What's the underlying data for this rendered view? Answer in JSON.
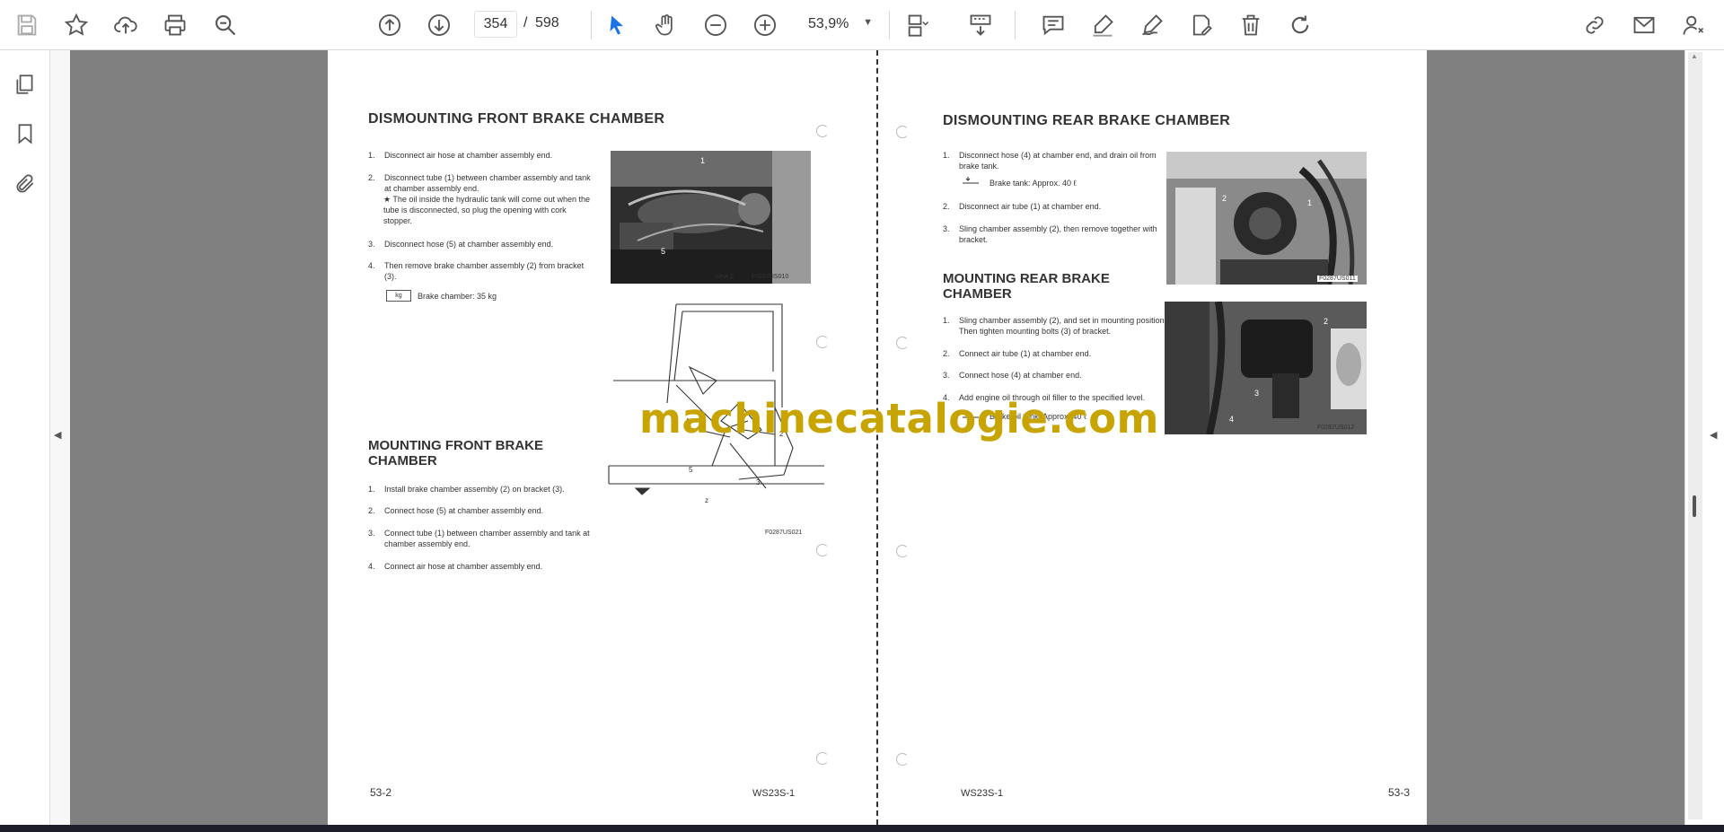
{
  "toolbar": {
    "page_current": "354",
    "page_separator": "/",
    "page_total": "598",
    "zoom": "53,9%"
  },
  "watermark": "machinecatalogie.com",
  "left_page": {
    "title_dismount": "DISMOUNTING FRONT BRAKE CHAMBER",
    "dismount_steps": [
      {
        "n": "1.",
        "t": "Disconnect air hose at chamber assembly end."
      },
      {
        "n": "2.",
        "t": "Disconnect tube (1) between chamber assembly and tank at chamber assembly end."
      },
      {
        "n": "3.",
        "t": "Disconnect hose (5) at chamber assembly end."
      },
      {
        "n": "4.",
        "t": "Then remove brake chamber assembly (2) from bracket (3)."
      }
    ],
    "dismount_note": "★  The oil inside the hydraulic tank will come out when the tube is disconnected, so plug the opening with cork stopper.",
    "weight_icon_label": "kg",
    "weight_text": "Brake chamber:  35 kg",
    "photo_caption_view": "View Z",
    "photo_caption_code": "F0287US010",
    "title_mount": "MOUNTING FRONT BRAKE CHAMBER",
    "mount_steps": [
      {
        "n": "1.",
        "t": "Install brake chamber assembly (2) on bracket (3)."
      },
      {
        "n": "2.",
        "t": "Connect hose (5) at chamber assembly end."
      },
      {
        "n": "3.",
        "t": "Connect tube (1) between chamber assembly and tank at chamber assembly end."
      },
      {
        "n": "4.",
        "t": "Connect air hose at chamber assembly end."
      }
    ],
    "diagram_labels": [
      "4",
      "2",
      "5",
      "3",
      "z"
    ],
    "diagram_code": "F0287US021",
    "footer_page": "53-2",
    "footer_model": "WS23S-1"
  },
  "right_page": {
    "title_dismount": "DISMOUNTING REAR BRAKE CHAMBER",
    "dismount_steps": [
      {
        "n": "1.",
        "t": "Disconnect hose (4) at chamber end, and drain oil from brake tank."
      },
      {
        "n": "2.",
        "t": "Disconnect air tube (1) at chamber end."
      },
      {
        "n": "3.",
        "t": "Sling chamber assembly (2), then remove together with bracket."
      }
    ],
    "tank_text_1": "Brake tank:  Approx. 40 ℓ",
    "title_mount": "MOUNTING REAR BRAKE CHAMBER",
    "mount_steps": [
      {
        "n": "1.",
        "t": "Sling chamber assembly (2), and set in mounting position. Then tighten mounting bolts (3) of bracket."
      },
      {
        "n": "2.",
        "t": "Connect air tube (1) at chamber end."
      },
      {
        "n": "3.",
        "t": "Connect hose (4) at chamber end."
      },
      {
        "n": "4.",
        "t": "Add engine oil through oil filler to the specified level."
      }
    ],
    "tank_text_2": "Brake oil tank:  Approx. 40 ℓ",
    "photo1_code": "F0287US011",
    "photo2_code": "F0287US012",
    "footer_model": "WS23S-1",
    "footer_page": "53-3"
  }
}
